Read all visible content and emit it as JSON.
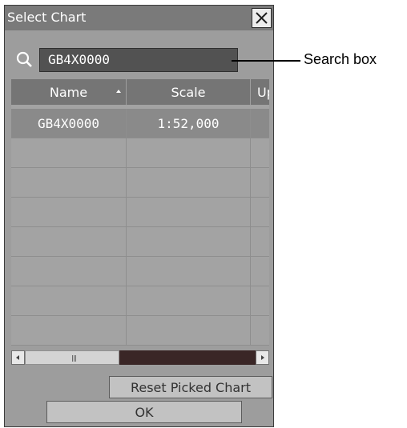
{
  "window": {
    "title": "Select Chart"
  },
  "search": {
    "value": "GB4X0000"
  },
  "table": {
    "columns": [
      "Name",
      "Scale",
      "Up"
    ],
    "rows": [
      [
        "GB4X0000",
        "1:52,000",
        ""
      ],
      [
        "",
        "",
        ""
      ],
      [
        "",
        "",
        ""
      ],
      [
        "",
        "",
        ""
      ],
      [
        "",
        "",
        ""
      ],
      [
        "",
        "",
        ""
      ],
      [
        "",
        "",
        ""
      ],
      [
        "",
        "",
        ""
      ]
    ]
  },
  "buttons": {
    "reset": "Reset Picked Chart",
    "ok": "OK"
  },
  "annotation": {
    "label": "Search box"
  },
  "icons": [
    "close-icon",
    "search-icon",
    "sort-ascending-icon",
    "scroll-left-icon",
    "scroll-right-icon"
  ]
}
